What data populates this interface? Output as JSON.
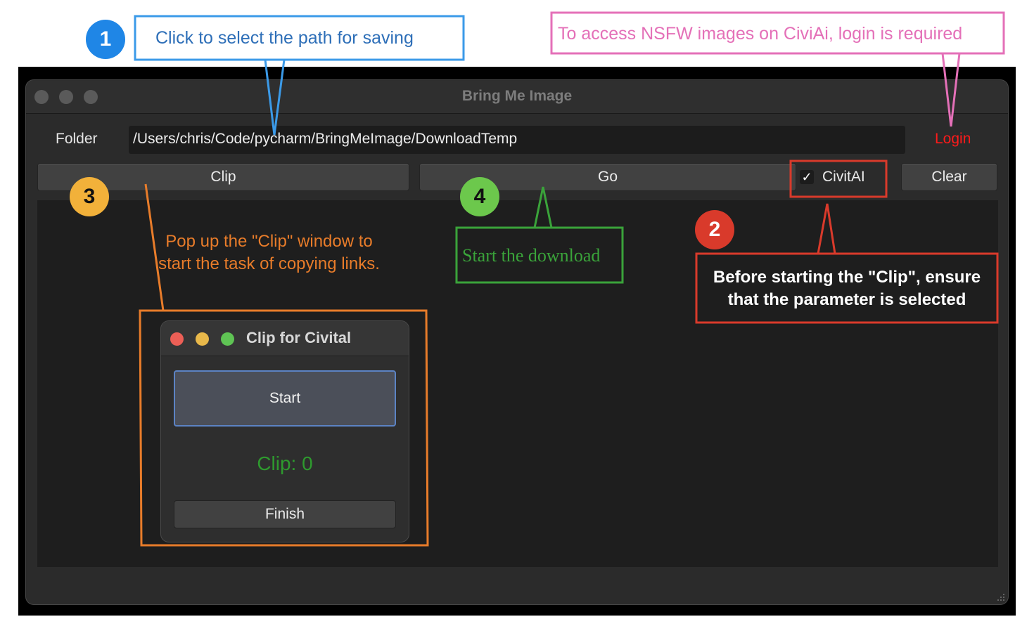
{
  "window": {
    "title": "Bring Me Image",
    "folder_label": "Folder",
    "folder_path": "/Users/chris/Code/pycharm/BringMeImage/DownloadTemp",
    "login_label": "Login",
    "buttons": {
      "clip": "Clip",
      "go": "Go",
      "clear": "Clear"
    },
    "civitai_checkbox": {
      "label": "CivitAI",
      "checked": true,
      "mark": "✓"
    }
  },
  "clip_window": {
    "title": "Clip for Civital",
    "start_label": "Start",
    "clip_count_text": "Clip: 0",
    "finish_label": "Finish"
  },
  "annotations": {
    "step1": {
      "number": "1",
      "text": "Click to select the path for saving",
      "color": "#2e6fb8"
    },
    "step2": {
      "number": "2",
      "text": "Before starting the \"Clip\", ensure that the parameter is  selected",
      "color": "#d93a2b"
    },
    "step3": {
      "number": "3",
      "text": "Pop up the \"Clip\" window to start the task of copying links.",
      "color": "#e87c2a"
    },
    "step4": {
      "number": "4",
      "text": "Start the download",
      "color": "#3aa33a"
    },
    "login_note": {
      "text": "To access NSFW images on CiviAi, login is required",
      "color": "#e470b8"
    }
  }
}
